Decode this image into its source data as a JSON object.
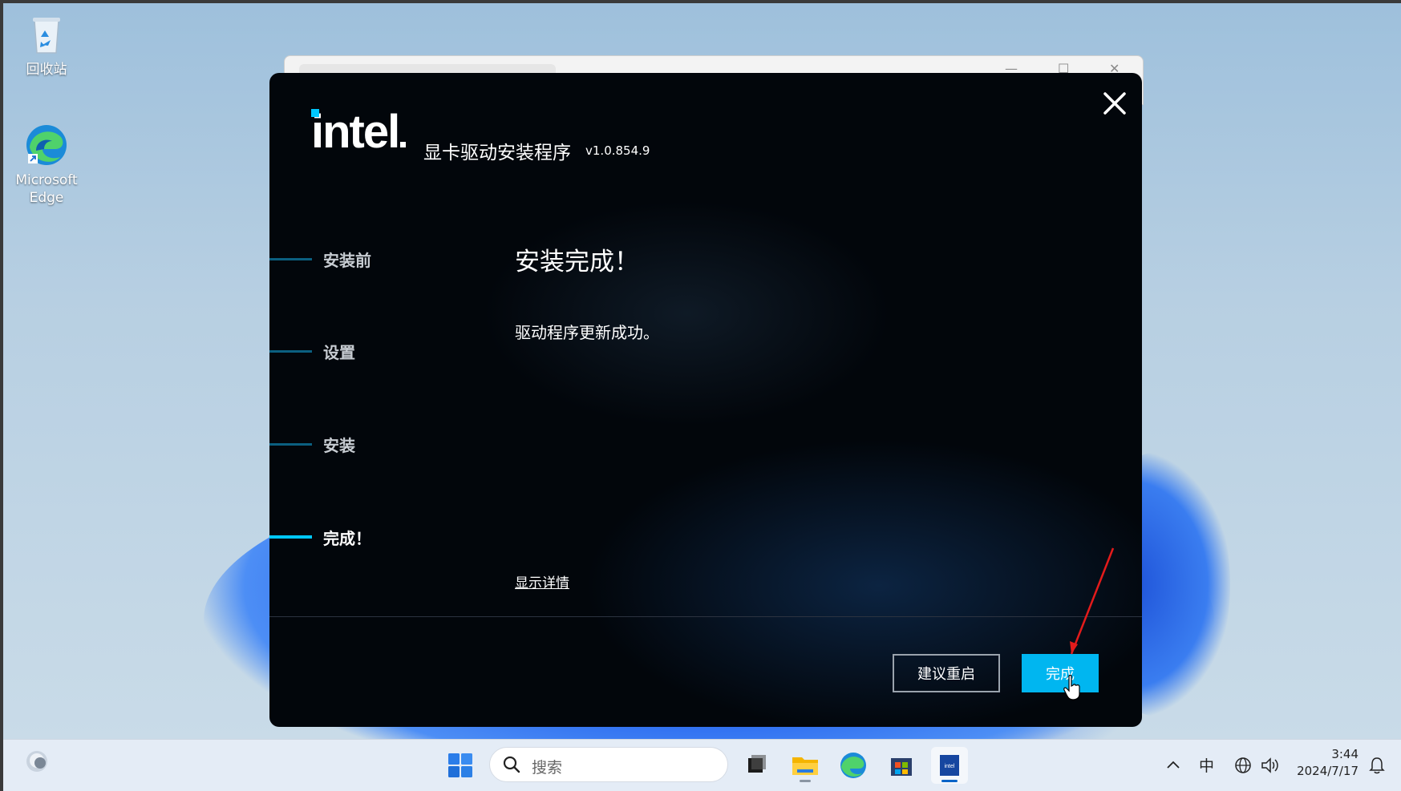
{
  "desktop": {
    "icons": [
      {
        "label": "回收站",
        "icon": "recycle-bin-icon"
      },
      {
        "label": "Microsoft Edge",
        "icon": "edge-icon"
      }
    ]
  },
  "installer": {
    "brand": "intel",
    "title": "显卡驱动安装程序",
    "version": "v1.0.854.9",
    "steps": [
      {
        "label": "安装前",
        "active": false
      },
      {
        "label": "设置",
        "active": false
      },
      {
        "label": "安装",
        "active": false
      },
      {
        "label": "完成！",
        "active": true
      }
    ],
    "heading": "安装完成！",
    "message": "驱动程序更新成功。",
    "details_link": "显示详情",
    "restart_button": "建议重启",
    "finish_button": "完成",
    "accent_color": "#00c7fd"
  },
  "taskbar": {
    "search_placeholder": "搜索",
    "tray": {
      "ime": "中",
      "time": "3:44",
      "date": "2024/7/17"
    }
  }
}
